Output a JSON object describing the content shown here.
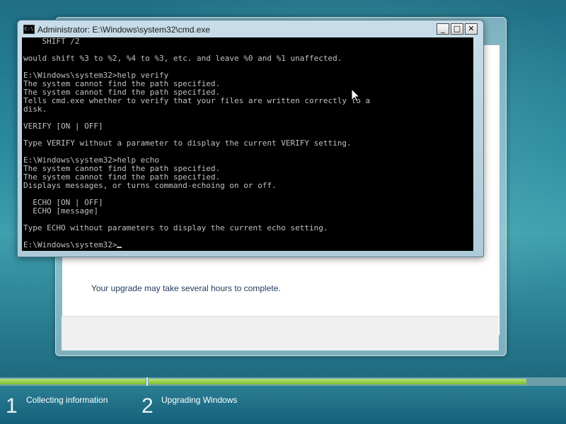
{
  "cmd": {
    "title": "Administrator: E:\\Windows\\system32\\cmd.exe",
    "icon_label": "C:\\",
    "buttons": {
      "minimize": "_",
      "maximize": "□",
      "close": "✕"
    },
    "lines": [
      "    SHIFT /2",
      "",
      "would shift %3 to %2, %4 to %3, etc. and leave %0 and %1 unaffected.",
      "",
      "E:\\Windows\\system32>help verify",
      "The system cannot find the path specified.",
      "The system cannot find the path specified.",
      "Tells cmd.exe whether to verify that your files are written correctly to a",
      "disk.",
      "",
      "VERIFY [ON | OFF]",
      "",
      "Type VERIFY without a parameter to display the current VERIFY setting.",
      "",
      "E:\\Windows\\system32>help echo",
      "The system cannot find the path specified.",
      "The system cannot find the path specified.",
      "Displays messages, or turns command-echoing on or off.",
      "",
      "  ECHO [ON | OFF]",
      "  ECHO [message]",
      "",
      "Type ECHO without parameters to display the current echo setting.",
      ""
    ],
    "prompt": "E:\\Windows\\system32>"
  },
  "setup": {
    "upgrade_note": "Your upgrade may take several hours to complete."
  },
  "steps": [
    {
      "number": "1",
      "label": "Collecting information"
    },
    {
      "number": "2",
      "label": "Upgrading Windows"
    }
  ],
  "progress": {
    "step1_complete": 1.0,
    "step2_fraction": 0.92
  },
  "colors": {
    "progress_green": "#7cbf2d",
    "console_bg": "#000000",
    "console_fg": "#c0c0c0"
  }
}
